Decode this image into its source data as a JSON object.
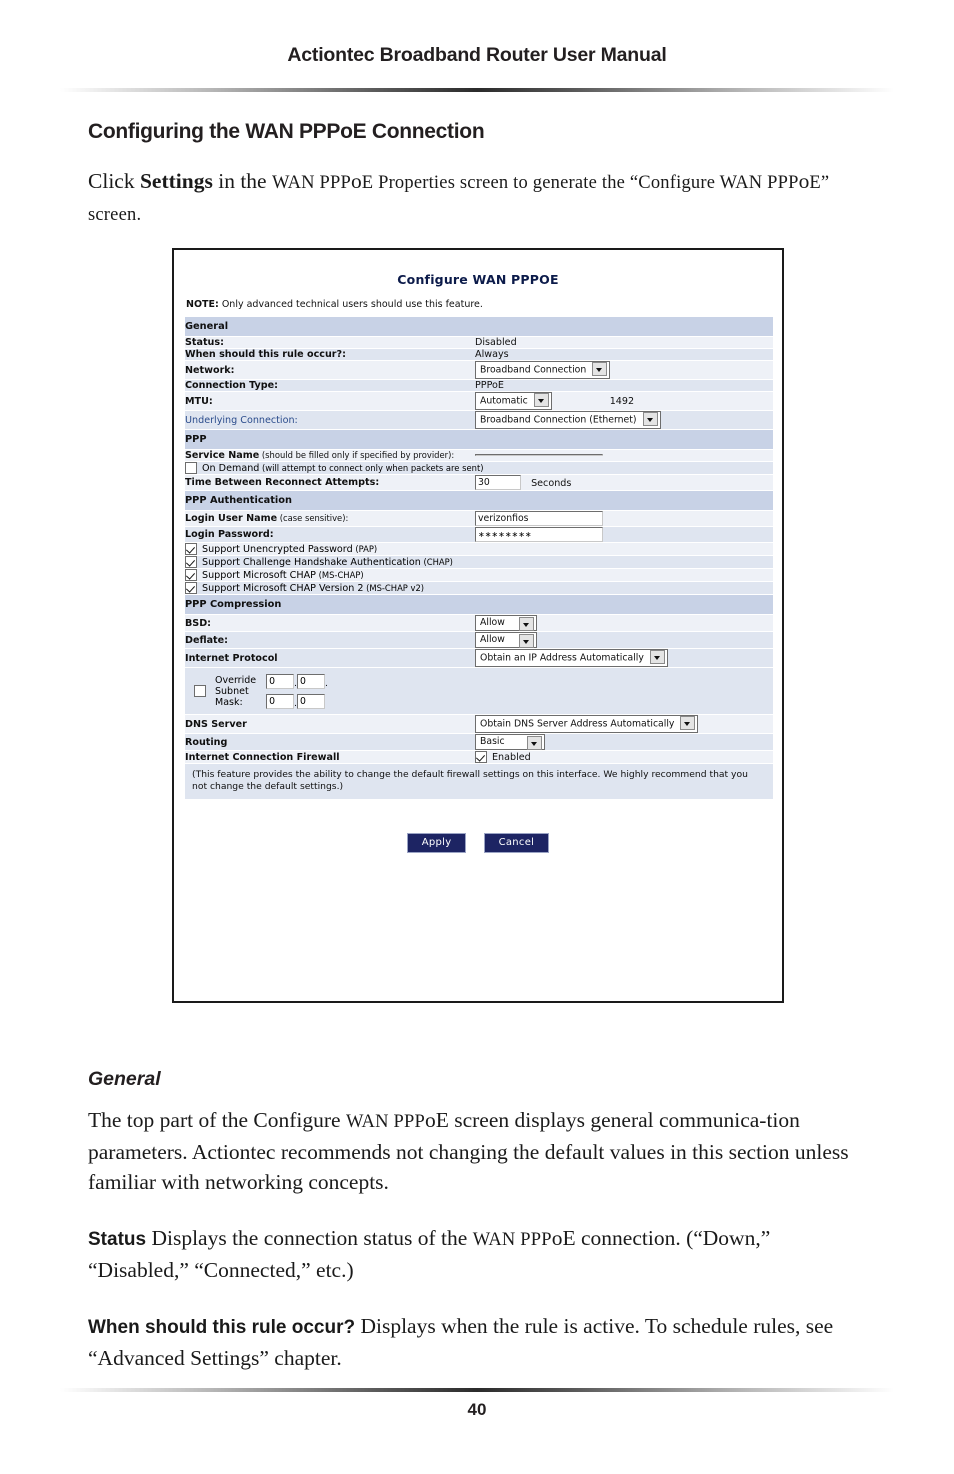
{
  "document": {
    "running_head": "Actiontec Broadband Router User Manual",
    "page_number": "40",
    "section_title": "Configuring the WAN PPPoE Connection",
    "intro_p1_a": "Click ",
    "intro_p1_b": "Settings",
    "intro_p1_c": " in the ",
    "intro_p1_d": "WAN PPP",
    "intro_p1_e": "o",
    "intro_p1_f": "E Properties screen to generate the “Configure ",
    "intro_p1_g": "WAN PPP",
    "intro_p1_h": "o",
    "intro_p1_i": "E” screen.",
    "sub_title": "General",
    "general_p_a": "The top part of the Configure ",
    "general_p_b": "WAN PPP",
    "general_p_c": "o",
    "general_p_d": "E screen displays general communica-tion parameters. Actiontec recommends not changing the default values in this section unless familiar with networking concepts.",
    "status_term": "Status",
    "status_def_a": "  Displays the connection status of the ",
    "status_def_b": "WAN PPP",
    "status_def_c": "o",
    "status_def_d": "E connection. (“Down,” “Disabled,” “Connected,” etc.)",
    "rule_term": "When should this rule occur?",
    "rule_def": "  Displays when the rule is active. To schedule rules, see “Advanced Settings” chapter."
  },
  "screen": {
    "title": "Configure WAN PPPOE",
    "note_label": "NOTE:",
    "note_text": " Only advanced technical users should use this feature.",
    "sections": {
      "general": "General",
      "ppp": "PPP",
      "ppp_authentication": "PPP Authentication",
      "ppp_compression": "PPP Compression"
    },
    "rows": {
      "status_label": "Status:",
      "status_value": "Disabled",
      "when_label": "When should this rule occur?:",
      "when_value": "Always",
      "network_label": "Network:",
      "network_value": "Broadband Connection",
      "conn_type_label": "Connection Type:",
      "conn_type_value": "PPPoE",
      "mtu_label": "MTU:",
      "mtu_value": "Automatic",
      "mtu_number": "1492",
      "underlying_label": "Underlying Connection:",
      "underlying_value": "Broadband Connection (Ethernet)",
      "service_name_label": "Service Name",
      "service_name_hint": " (should be filled only if specified by provider):",
      "service_name_value": "",
      "on_demand_label": "On Demand",
      "on_demand_hint": " (will attempt to connect only when packets are sent)",
      "reconnect_label": "Time Between Reconnect Attempts:",
      "reconnect_value": "30",
      "reconnect_unit": "Seconds",
      "login_user_label": "Login User Name",
      "login_user_hint": " (case sensitive):",
      "login_user_value": "verizonfios",
      "login_pass_label": "Login Password:",
      "login_pass_value": "∗∗∗∗∗∗∗∗",
      "pap_label": "Support Unencrypted Password",
      "pap_hint": " (PAP)",
      "chap_label": "Support Challenge Handshake Authentication",
      "chap_hint": " (CHAP)",
      "mschap_label": "Support Microsoft CHAP",
      "mschap_hint": " (MS-CHAP)",
      "mschap2_label": "Support Microsoft CHAP Version 2",
      "mschap2_hint": " (MS-CHAP v2)",
      "bsd_label": "BSD:",
      "bsd_value": "Allow",
      "deflate_label": "Deflate:",
      "deflate_value": "Allow",
      "internet_protocol_label": "Internet Protocol",
      "internet_protocol_value": "Obtain an IP Address Automatically",
      "override_label_l1": "Override",
      "override_label_l2": "Subnet",
      "override_label_l3": "Mask:",
      "override_o1": "0",
      "override_o2": "0",
      "override_o3": "0",
      "override_o4": "0",
      "dns_label": "DNS Server",
      "dns_value": "Obtain DNS Server Address Automatically",
      "routing_label": "Routing",
      "routing_value": "Basic",
      "firewall_label": "Internet Connection Firewall",
      "firewall_value": "Enabled",
      "firewall_note": "(This feature provides the ability to change the default firewall settings on this interface. We highly recommend that you not change the default settings.)"
    },
    "buttons": {
      "apply": "Apply",
      "cancel": "Cancel"
    },
    "colors": {
      "row_dark": "#dfe5f0",
      "row_light": "#eef1f7",
      "header_row": "#c8d2e6",
      "title": "#0c1b4a",
      "link": "#2b4c8c",
      "button": "#1d2463"
    }
  }
}
